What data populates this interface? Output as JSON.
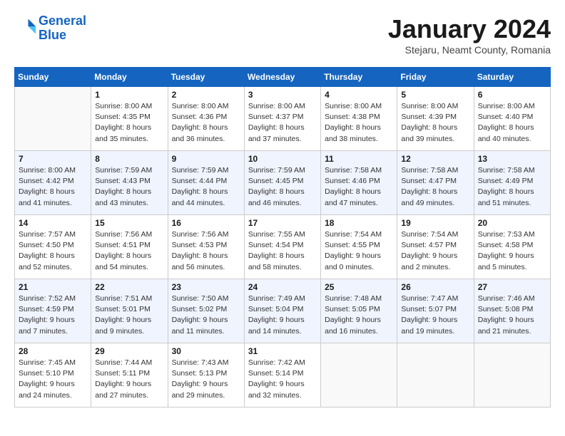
{
  "header": {
    "logo_line1": "General",
    "logo_line2": "Blue",
    "month": "January 2024",
    "location": "Stejaru, Neamt County, Romania"
  },
  "days_of_week": [
    "Sunday",
    "Monday",
    "Tuesday",
    "Wednesday",
    "Thursday",
    "Friday",
    "Saturday"
  ],
  "weeks": [
    [
      {
        "day": "",
        "info": ""
      },
      {
        "day": "1",
        "info": "Sunrise: 8:00 AM\nSunset: 4:35 PM\nDaylight: 8 hours\nand 35 minutes."
      },
      {
        "day": "2",
        "info": "Sunrise: 8:00 AM\nSunset: 4:36 PM\nDaylight: 8 hours\nand 36 minutes."
      },
      {
        "day": "3",
        "info": "Sunrise: 8:00 AM\nSunset: 4:37 PM\nDaylight: 8 hours\nand 37 minutes."
      },
      {
        "day": "4",
        "info": "Sunrise: 8:00 AM\nSunset: 4:38 PM\nDaylight: 8 hours\nand 38 minutes."
      },
      {
        "day": "5",
        "info": "Sunrise: 8:00 AM\nSunset: 4:39 PM\nDaylight: 8 hours\nand 39 minutes."
      },
      {
        "day": "6",
        "info": "Sunrise: 8:00 AM\nSunset: 4:40 PM\nDaylight: 8 hours\nand 40 minutes."
      }
    ],
    [
      {
        "day": "7",
        "info": "Sunrise: 8:00 AM\nSunset: 4:42 PM\nDaylight: 8 hours\nand 41 minutes."
      },
      {
        "day": "8",
        "info": "Sunrise: 7:59 AM\nSunset: 4:43 PM\nDaylight: 8 hours\nand 43 minutes."
      },
      {
        "day": "9",
        "info": "Sunrise: 7:59 AM\nSunset: 4:44 PM\nDaylight: 8 hours\nand 44 minutes."
      },
      {
        "day": "10",
        "info": "Sunrise: 7:59 AM\nSunset: 4:45 PM\nDaylight: 8 hours\nand 46 minutes."
      },
      {
        "day": "11",
        "info": "Sunrise: 7:58 AM\nSunset: 4:46 PM\nDaylight: 8 hours\nand 47 minutes."
      },
      {
        "day": "12",
        "info": "Sunrise: 7:58 AM\nSunset: 4:47 PM\nDaylight: 8 hours\nand 49 minutes."
      },
      {
        "day": "13",
        "info": "Sunrise: 7:58 AM\nSunset: 4:49 PM\nDaylight: 8 hours\nand 51 minutes."
      }
    ],
    [
      {
        "day": "14",
        "info": "Sunrise: 7:57 AM\nSunset: 4:50 PM\nDaylight: 8 hours\nand 52 minutes."
      },
      {
        "day": "15",
        "info": "Sunrise: 7:56 AM\nSunset: 4:51 PM\nDaylight: 8 hours\nand 54 minutes."
      },
      {
        "day": "16",
        "info": "Sunrise: 7:56 AM\nSunset: 4:53 PM\nDaylight: 8 hours\nand 56 minutes."
      },
      {
        "day": "17",
        "info": "Sunrise: 7:55 AM\nSunset: 4:54 PM\nDaylight: 8 hours\nand 58 minutes."
      },
      {
        "day": "18",
        "info": "Sunrise: 7:54 AM\nSunset: 4:55 PM\nDaylight: 9 hours\nand 0 minutes."
      },
      {
        "day": "19",
        "info": "Sunrise: 7:54 AM\nSunset: 4:57 PM\nDaylight: 9 hours\nand 2 minutes."
      },
      {
        "day": "20",
        "info": "Sunrise: 7:53 AM\nSunset: 4:58 PM\nDaylight: 9 hours\nand 5 minutes."
      }
    ],
    [
      {
        "day": "21",
        "info": "Sunrise: 7:52 AM\nSunset: 4:59 PM\nDaylight: 9 hours\nand 7 minutes."
      },
      {
        "day": "22",
        "info": "Sunrise: 7:51 AM\nSunset: 5:01 PM\nDaylight: 9 hours\nand 9 minutes."
      },
      {
        "day": "23",
        "info": "Sunrise: 7:50 AM\nSunset: 5:02 PM\nDaylight: 9 hours\nand 11 minutes."
      },
      {
        "day": "24",
        "info": "Sunrise: 7:49 AM\nSunset: 5:04 PM\nDaylight: 9 hours\nand 14 minutes."
      },
      {
        "day": "25",
        "info": "Sunrise: 7:48 AM\nSunset: 5:05 PM\nDaylight: 9 hours\nand 16 minutes."
      },
      {
        "day": "26",
        "info": "Sunrise: 7:47 AM\nSunset: 5:07 PM\nDaylight: 9 hours\nand 19 minutes."
      },
      {
        "day": "27",
        "info": "Sunrise: 7:46 AM\nSunset: 5:08 PM\nDaylight: 9 hours\nand 21 minutes."
      }
    ],
    [
      {
        "day": "28",
        "info": "Sunrise: 7:45 AM\nSunset: 5:10 PM\nDaylight: 9 hours\nand 24 minutes."
      },
      {
        "day": "29",
        "info": "Sunrise: 7:44 AM\nSunset: 5:11 PM\nDaylight: 9 hours\nand 27 minutes."
      },
      {
        "day": "30",
        "info": "Sunrise: 7:43 AM\nSunset: 5:13 PM\nDaylight: 9 hours\nand 29 minutes."
      },
      {
        "day": "31",
        "info": "Sunrise: 7:42 AM\nSunset: 5:14 PM\nDaylight: 9 hours\nand 32 minutes."
      },
      {
        "day": "",
        "info": ""
      },
      {
        "day": "",
        "info": ""
      },
      {
        "day": "",
        "info": ""
      }
    ]
  ]
}
